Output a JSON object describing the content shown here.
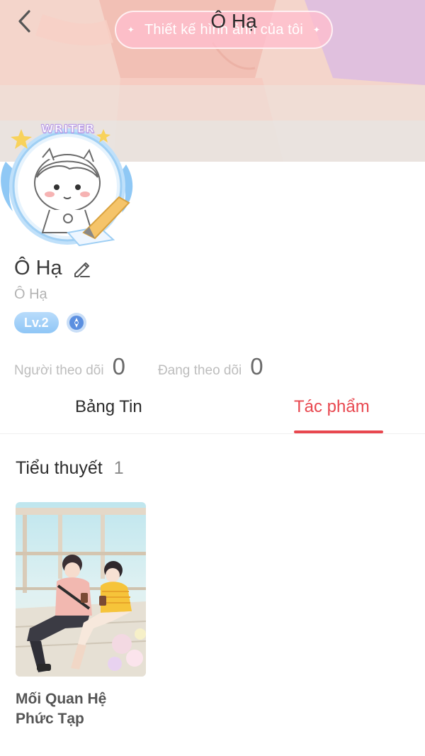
{
  "header": {
    "title": "Ô Hạ",
    "banner_button_label": "Thiết kế hình ảnh của tôi",
    "back_icon": "chevron-left-icon"
  },
  "profile": {
    "badge_text": "WRITER",
    "name": "Ô Hạ",
    "username": "Ô Hạ",
    "level": "Lv.2",
    "followers_label": "Người theo dõi",
    "followers_count": "0",
    "following_label": "Đang theo dõi",
    "following_count": "0"
  },
  "tabs": [
    {
      "label": "Bảng Tin",
      "active": false
    },
    {
      "label": "Tác phẩm",
      "active": true
    }
  ],
  "novels": {
    "section_label": "Tiểu thuyết",
    "count": "1",
    "items": [
      {
        "title": "Mối Quan Hệ Phức Tạp"
      }
    ]
  },
  "colors": {
    "accent": "#e8474f",
    "level_badge": "#9fcff7",
    "banner_pill": "#ffbecd"
  }
}
